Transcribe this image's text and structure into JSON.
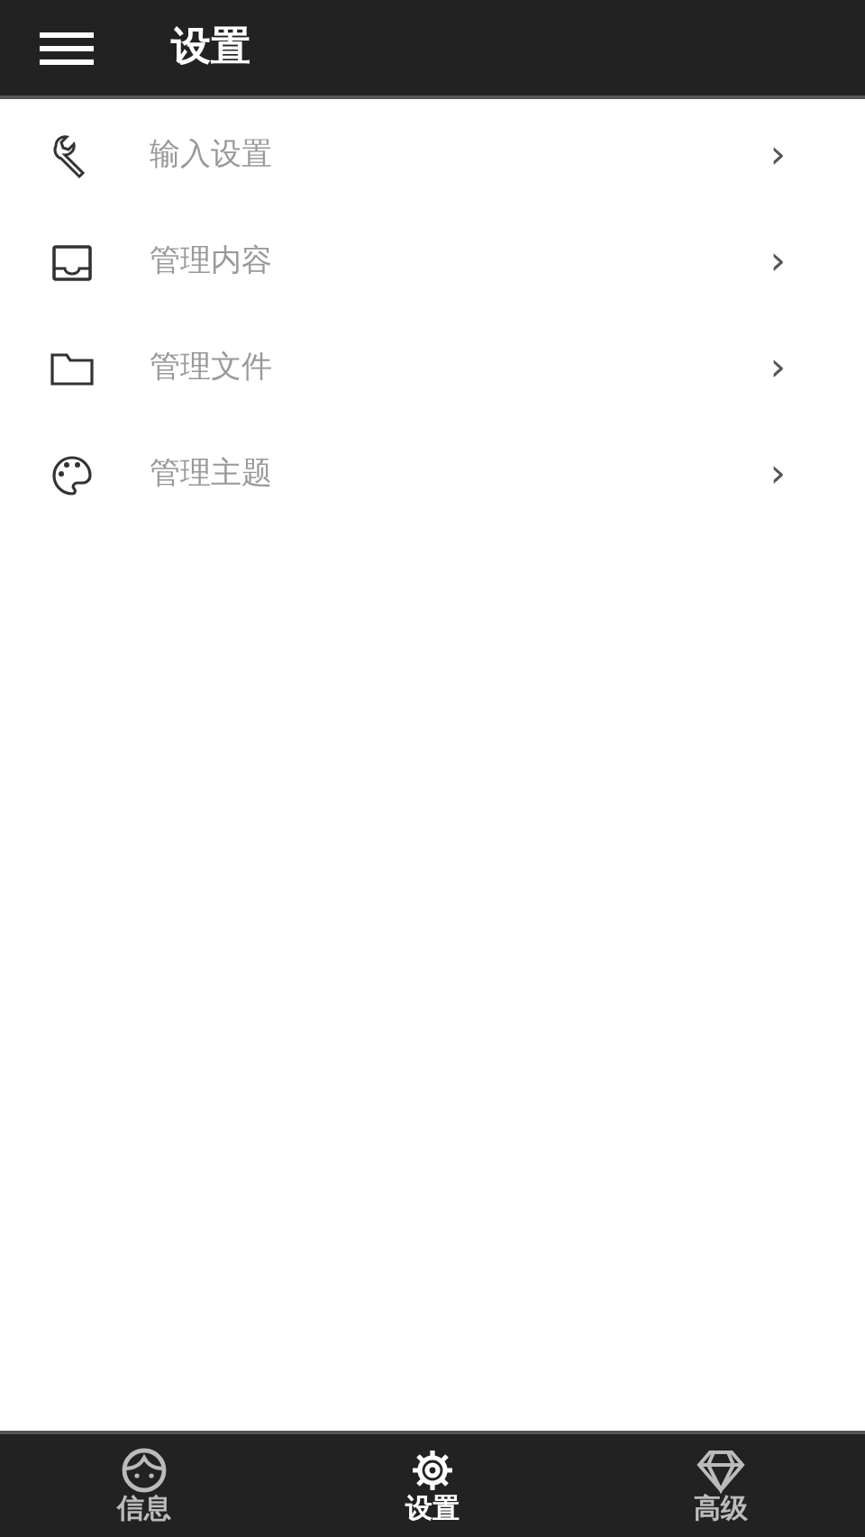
{
  "header": {
    "title": "设置"
  },
  "menu_items": [
    {
      "label": "输入设置",
      "chevron": "›"
    },
    {
      "label": "管理内容",
      "chevron": "›"
    },
    {
      "label": "管理文件",
      "chevron": "›"
    },
    {
      "label": "管理主题",
      "chevron": "›"
    }
  ],
  "tabs": [
    {
      "label": "信息",
      "selected": false
    },
    {
      "label": "设置",
      "selected": true
    },
    {
      "label": "高级",
      "selected": false
    }
  ]
}
